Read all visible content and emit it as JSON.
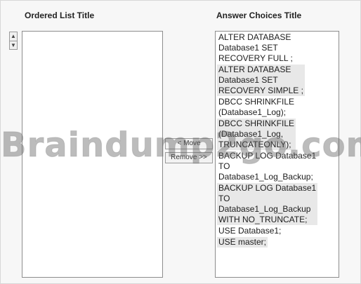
{
  "titles": {
    "ordered_list": "Ordered List Title",
    "answer_choices": "Answer Choices Title"
  },
  "buttons": {
    "move": "< Move",
    "remove": "Remove >>"
  },
  "answer_choices": [
    "ALTER DATABASE\nDatabase1 SET\nRECOVERY FULL ;",
    "ALTER DATABASE\nDatabase1 SET\nRECOVERY SIMPLE ;",
    "DBCC SHRINKFILE\n(Database1_Log);",
    "DBCC SHRINKFILE\n(Database1_Log,\nTRUNCATEONLY);",
    "BACKUP LOG Database1\n   TO\nDatabase1_Log_Backup;",
    "BACKUP LOG Database1\n   TO\nDatabase1_Log_Backup\n   WITH NO_TRUNCATE;",
    "USE Database1;",
    "USE master;"
  ],
  "watermark": "Braindump2go.com"
}
